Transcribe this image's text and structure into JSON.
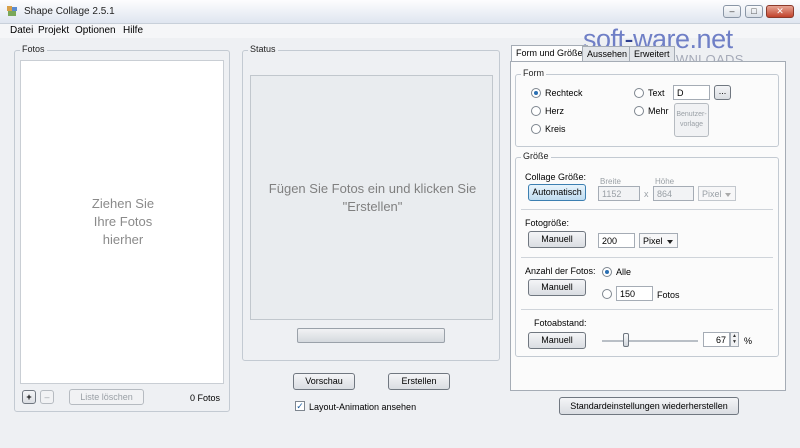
{
  "window": {
    "title": "Shape Collage 2.5.1",
    "minimize": "–",
    "maximize": "□",
    "close": "✕"
  },
  "menu": [
    "Datei",
    "Projekt",
    "Optionen",
    "Hilfe"
  ],
  "watermark": {
    "main_a": "soft",
    "main_dash": "-",
    "main_b": "ware.net",
    "sub": "AKTUELLE DOWNLOADS"
  },
  "fotos": {
    "title": "Fotos",
    "hint_line1": "Ziehen Sie",
    "hint_line2": "Ihre Fotos",
    "hint_line3": "hierher",
    "add": "+",
    "remove": "–",
    "clear": "Liste löschen",
    "count": "0 Fotos"
  },
  "status": {
    "title": "Status",
    "hint_line1": "Fügen Sie Fotos ein und klicken Sie",
    "hint_line2": "\"Erstellen\"",
    "progress": 0,
    "preview": "Vorschau",
    "create": "Erstellen",
    "animation_checked": true,
    "animation_check": "✓",
    "animation_label": "Layout-Animation ansehen"
  },
  "tabs": [
    "Form und Größe",
    "Aussehen",
    "Erweitert"
  ],
  "form": {
    "title": "Form",
    "rechteck": "Rechteck",
    "herz": "Herz",
    "kreis": "Kreis",
    "text": "Text",
    "text_value": "D",
    "browse": "...",
    "mehr": "Mehr",
    "custom_line1": "Benutzer-",
    "custom_line2": "vorlage",
    "selected": "Rechteck"
  },
  "size": {
    "title": "Größe",
    "collage_label": "Collage Größe:",
    "collage_button": "Automatisch",
    "width_label": "Breite",
    "height_label": "Höhe",
    "width": "1152",
    "times": "x",
    "height": "864",
    "unit": "Pixel",
    "photo_label": "Fotogröße:",
    "photo_button": "Manuell",
    "photo_size": "200",
    "photo_unit": "Pixel",
    "count_label": "Anzahl der Fotos:",
    "count_button": "Manuell",
    "count_all": "Alle",
    "count_value": "150",
    "count_suffix": "Fotos",
    "spacing_label": "Fotoabstand:",
    "spacing_button": "Manuell",
    "spacing_value": "67",
    "spacing_slider": 0.25,
    "percent": "%"
  },
  "reset": "Standardeinstellungen wiederherstellen"
}
